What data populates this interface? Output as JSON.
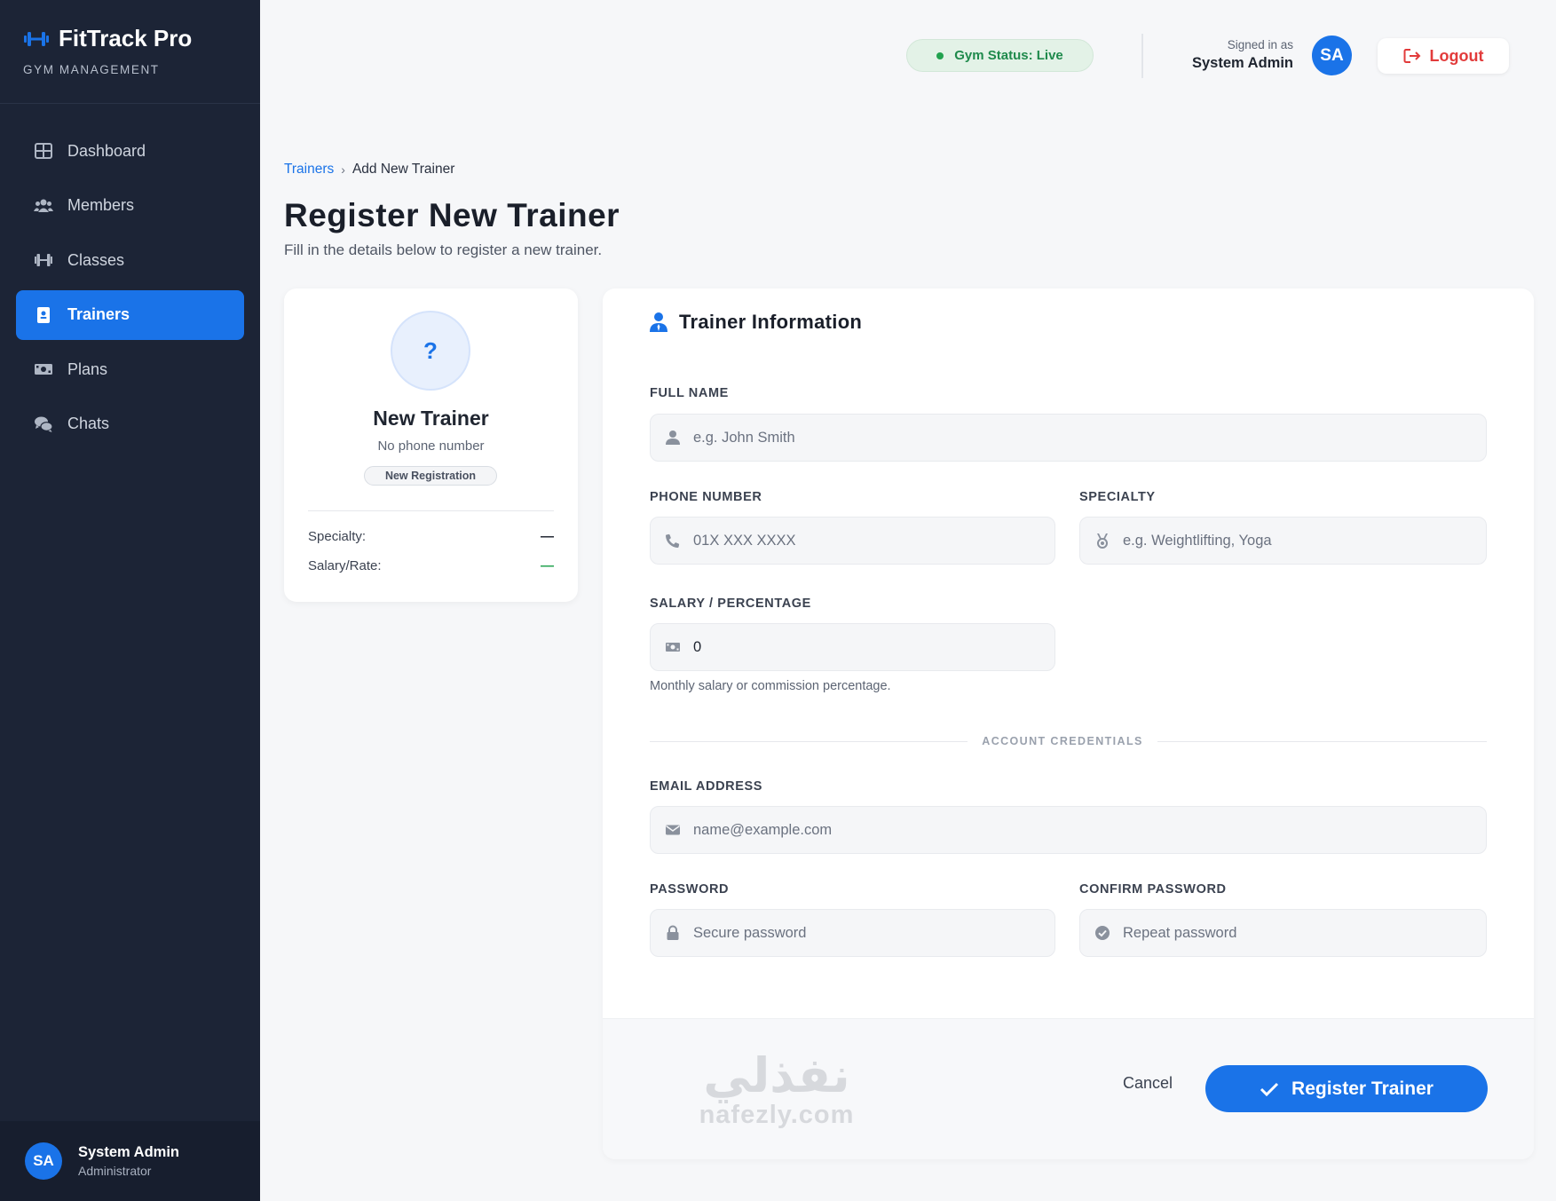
{
  "brand": {
    "title": "FitTrack Pro",
    "subtitle": "GYM MANAGEMENT",
    "accent": "#1a73e8"
  },
  "sidebar": {
    "items": [
      {
        "label": "Dashboard",
        "icon": "grid-icon",
        "active": false
      },
      {
        "label": "Members",
        "icon": "users-icon",
        "active": false
      },
      {
        "label": "Classes",
        "icon": "dumbbell-icon",
        "active": false
      },
      {
        "label": "Trainers",
        "icon": "id-badge-icon",
        "active": true
      },
      {
        "label": "Plans",
        "icon": "money-icon",
        "active": false
      },
      {
        "label": "Chats",
        "icon": "comments-icon",
        "active": false
      }
    ],
    "user": {
      "initials": "SA",
      "name": "System Admin",
      "role": "Administrator"
    }
  },
  "header": {
    "status": "Gym Status: Live",
    "status_color": "#22a24f",
    "signed_label": "Signed in as",
    "signed_name": "System Admin",
    "initials": "SA",
    "logout": "Logout",
    "logout_color": "#e23b3b"
  },
  "breadcrumb": {
    "parent": "Trainers",
    "current": "Add New Trainer"
  },
  "page": {
    "title": "Register New Trainer",
    "subtitle": "Fill in the details below to register a new trainer."
  },
  "preview": {
    "avatar_symbol": "?",
    "name": "New Trainer",
    "phone": "No phone number",
    "badge": "New Registration",
    "specialty_label": "Specialty:",
    "specialty_value": "—",
    "salary_label": "Salary/Rate:",
    "salary_value": "—"
  },
  "form": {
    "heading": "Trainer Information",
    "full_name": {
      "label": "FULL NAME",
      "placeholder": "e.g. John Smith",
      "value": ""
    },
    "phone": {
      "label": "PHONE NUMBER",
      "placeholder": "01X XXX XXXX",
      "value": ""
    },
    "specialty": {
      "label": "SPECIALTY",
      "placeholder": "e.g. Weightlifting, Yoga",
      "value": ""
    },
    "salary": {
      "label": "SALARY / PERCENTAGE",
      "placeholder": "",
      "value": "0",
      "helper": "Monthly salary or commission percentage."
    },
    "credentials_label": "ACCOUNT CREDENTIALS",
    "email": {
      "label": "EMAIL ADDRESS",
      "placeholder": "name@example.com",
      "value": ""
    },
    "password": {
      "label": "PASSWORD",
      "placeholder": "Secure password",
      "value": ""
    },
    "confirm_password": {
      "label": "CONFIRM PASSWORD",
      "placeholder": "Repeat password",
      "value": ""
    },
    "cancel": "Cancel",
    "submit": "Register Trainer"
  },
  "watermark": {
    "arabic": "نفذلي",
    "latin": "nafezly.com"
  }
}
